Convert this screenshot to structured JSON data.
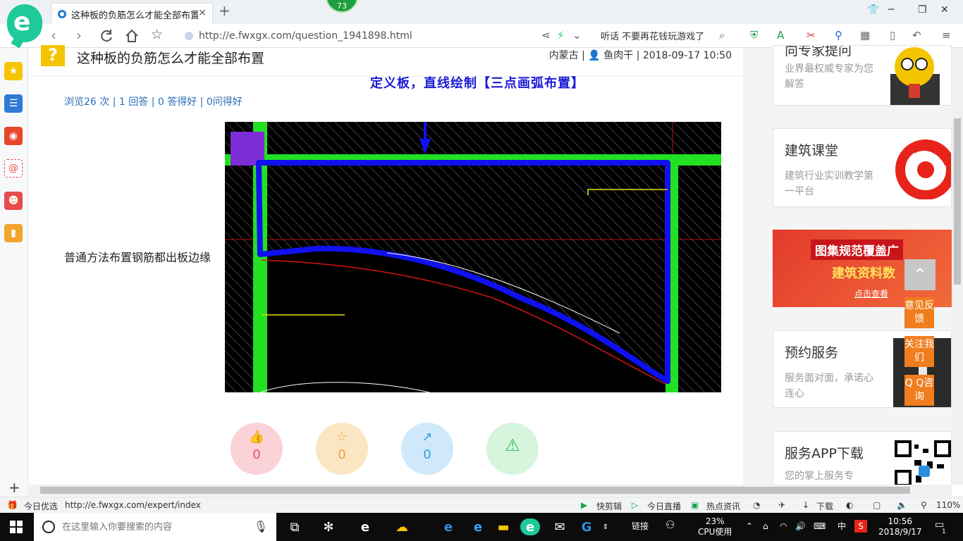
{
  "browser": {
    "tab_title": "这种板的负筋怎么才能全部布置...",
    "tab_close": "×",
    "new_tab": "+",
    "badge": "73",
    "url": "http://e.fwxgx.com/question_1941898.html",
    "search_hint": "听话 不要再花钱玩游戏了",
    "min": "─",
    "max": "❐",
    "close": "✕"
  },
  "page": {
    "question_mark": "?",
    "title": "这种板的负筋怎么才能全部布置",
    "meta_region": "内蒙古",
    "meta_user": "鱼肉干",
    "meta_time": "2018-09-17 10:50",
    "stats": "浏览26 次 | 1 回答 | 0 答得好 | 0问得好",
    "annotation": "定义板，直线绘制【三点画弧布置】",
    "body_text": "普通方法布置钢筋都出板边缘",
    "votes": [
      {
        "icon": "👍",
        "count": "0"
      },
      {
        "icon": "☆",
        "count": "0"
      },
      {
        "icon": "↗",
        "count": "0"
      },
      {
        "icon": "⚠",
        "count": ""
      }
    ]
  },
  "sidebar": {
    "cards": [
      {
        "title": "向专家提问",
        "sub": "业界最权威专家为您解答"
      },
      {
        "title": "建筑课堂",
        "sub": "建筑行业实训教学第一平台"
      },
      {
        "title": "预约服务",
        "sub": "服务面对面，承诺心连心"
      },
      {
        "title": "服务APP下载",
        "sub": "您的掌上服务专"
      }
    ],
    "banner": {
      "line1": "图集规范覆盖广",
      "line2": "建筑资料数",
      "line3": "点击查看"
    },
    "float_buttons": [
      "意见反馈",
      "关注我们",
      "Q Q咨询"
    ],
    "to_top": "⌃"
  },
  "statusbar": {
    "daily": "今日优选",
    "url": "http://e.fwxgx.com/expert/index",
    "items": [
      "快剪辑",
      "今日直播",
      "热点资讯",
      "下载"
    ],
    "zoom": "110%"
  },
  "taskbar": {
    "search_placeholder": "在这里输入你要搜索的内容",
    "links": "链接",
    "cpu_percent": "23%",
    "cpu_label": "CPU使用",
    "ime": "中",
    "time": "10:56",
    "date": "2018/9/17",
    "notif_count": "1"
  },
  "colors": {
    "accent": "#1ec99a",
    "link": "#2a6db5",
    "annotation": "#1a1ad6",
    "float_orange": "#f07d1e"
  }
}
